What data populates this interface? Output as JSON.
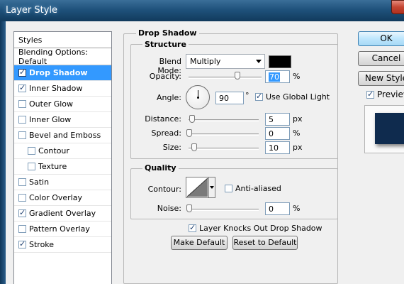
{
  "window": {
    "title": "Layer Style"
  },
  "styles_panel": {
    "header": "Styles",
    "items": [
      {
        "label": "Blending Options: Default",
        "has_checkbox": false,
        "checked": false,
        "selected": false,
        "indent": false
      },
      {
        "label": "Drop Shadow",
        "has_checkbox": true,
        "checked": true,
        "selected": true,
        "indent": false
      },
      {
        "label": "Inner Shadow",
        "has_checkbox": true,
        "checked": true,
        "selected": false,
        "indent": false
      },
      {
        "label": "Outer Glow",
        "has_checkbox": true,
        "checked": false,
        "selected": false,
        "indent": false
      },
      {
        "label": "Inner Glow",
        "has_checkbox": true,
        "checked": false,
        "selected": false,
        "indent": false
      },
      {
        "label": "Bevel and Emboss",
        "has_checkbox": true,
        "checked": false,
        "selected": false,
        "indent": false
      },
      {
        "label": "Contour",
        "has_checkbox": true,
        "checked": false,
        "selected": false,
        "indent": true
      },
      {
        "label": "Texture",
        "has_checkbox": true,
        "checked": false,
        "selected": false,
        "indent": true
      },
      {
        "label": "Satin",
        "has_checkbox": true,
        "checked": false,
        "selected": false,
        "indent": false
      },
      {
        "label": "Color Overlay",
        "has_checkbox": true,
        "checked": false,
        "selected": false,
        "indent": false
      },
      {
        "label": "Gradient Overlay",
        "has_checkbox": true,
        "checked": true,
        "selected": false,
        "indent": false
      },
      {
        "label": "Pattern Overlay",
        "has_checkbox": true,
        "checked": false,
        "selected": false,
        "indent": false
      },
      {
        "label": "Stroke",
        "has_checkbox": true,
        "checked": true,
        "selected": false,
        "indent": false
      }
    ]
  },
  "drop_shadow": {
    "title": "Drop Shadow",
    "structure": {
      "title": "Structure",
      "blend_mode_label": "Blend Mode:",
      "blend_mode_value": "Multiply",
      "shadow_color": "#000000",
      "opacity_label": "Opacity:",
      "opacity_value": "70",
      "opacity_unit": "%",
      "angle_label": "Angle:",
      "angle_value": "90",
      "angle_unit": "°",
      "use_global_light_label": "Use Global Light",
      "use_global_light_checked": true,
      "distance_label": "Distance:",
      "distance_value": "5",
      "distance_unit": "px",
      "spread_label": "Spread:",
      "spread_value": "0",
      "spread_unit": "%",
      "size_label": "Size:",
      "size_value": "10",
      "size_unit": "px"
    },
    "quality": {
      "title": "Quality",
      "contour_label": "Contour:",
      "anti_aliased_label": "Anti-aliased",
      "anti_aliased_checked": false,
      "noise_label": "Noise:",
      "noise_value": "0",
      "noise_unit": "%"
    },
    "knocks_out_label": "Layer Knocks Out Drop Shadow",
    "knocks_out_checked": true,
    "make_default_label": "Make Default",
    "reset_default_label": "Reset to Default"
  },
  "buttons": {
    "ok": "OK",
    "cancel": "Cancel",
    "new_style": "New Style",
    "preview_label": "Preview",
    "preview_checked": true
  },
  "colors": {
    "selected_row": "#3399ff",
    "preview_swatch": "#0f2b4e",
    "titlebar": "#1f527c"
  }
}
